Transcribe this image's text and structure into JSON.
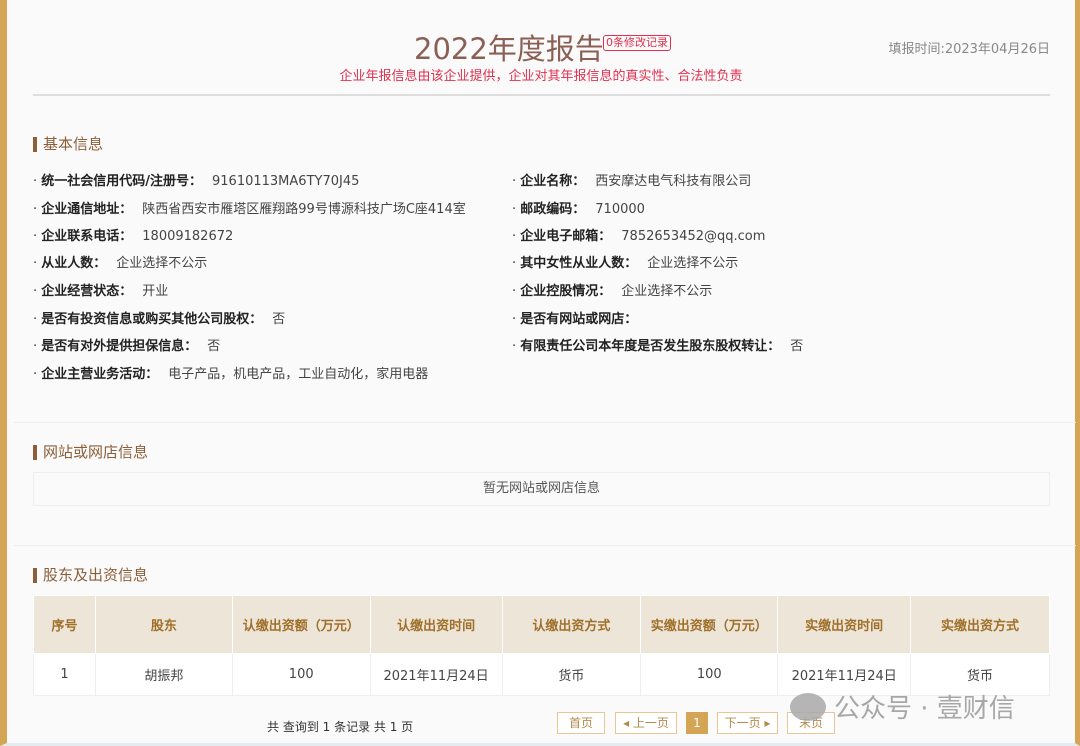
{
  "header": {
    "title": "2022年度报告",
    "badge": "0条修改记录",
    "filled_time": "填报时间:2023年04月26日",
    "notice": "企业年报信息由该企业提供，企业对其年报信息的真实性、合法性负责"
  },
  "sections": {
    "basic": "基本信息",
    "website": "网站或网店信息",
    "shareholders": "股东及出资信息"
  },
  "basic_left": [
    {
      "label": "统一社会信用代码/注册号：",
      "value": "91610113MA6TY70J45"
    },
    {
      "label": "企业通信地址：",
      "value": "陕西省西安市雁塔区雁翔路99号博源科技广场C座414室"
    },
    {
      "label": "企业联系电话：",
      "value": "18009182672"
    },
    {
      "label": "从业人数：",
      "value": "企业选择不公示"
    },
    {
      "label": "企业经营状态：",
      "value": "开业"
    },
    {
      "label": "是否有投资信息或购买其他公司股权：",
      "value": "否"
    },
    {
      "label": "是否有对外提供担保信息：",
      "value": "否"
    },
    {
      "label": "企业主营业务活动：",
      "value": "电子产品，机电产品，工业自动化，家用电器"
    }
  ],
  "basic_right": [
    {
      "label": "企业名称：",
      "value": "西安摩达电气科技有限公司"
    },
    {
      "label": "邮政编码：",
      "value": "710000"
    },
    {
      "label": "企业电子邮箱：",
      "value": "7852653452@qq.com"
    },
    {
      "label": "其中女性从业人数：",
      "value": "企业选择不公示"
    },
    {
      "label": "企业控股情况：",
      "value": "企业选择不公示"
    },
    {
      "label": "是否有网站或网店：",
      "value": ""
    },
    {
      "label": "有限责任公司本年度是否发生股东股权转让：",
      "value": "否"
    }
  ],
  "website_empty": "暂无网站或网店信息",
  "table": {
    "headers": [
      "序号",
      "股东",
      "认缴出资额（万元）",
      "认缴出资时间",
      "认缴出资方式",
      "实缴出资额（万元）",
      "实缴出资时间",
      "实缴出资方式"
    ],
    "rows": [
      [
        "1",
        "胡振邦",
        "100",
        "2021年11月24日",
        "货币",
        "100",
        "2021年11月24日",
        "货币"
      ]
    ]
  },
  "pagination": {
    "info": "共 查询到 1 条记录 共 1 页",
    "first": "首页",
    "prev": "◂ 上一页",
    "current": "1",
    "next": "下一页 ▸",
    "last": "末页"
  },
  "watermark": "公众号 · 壹财信"
}
